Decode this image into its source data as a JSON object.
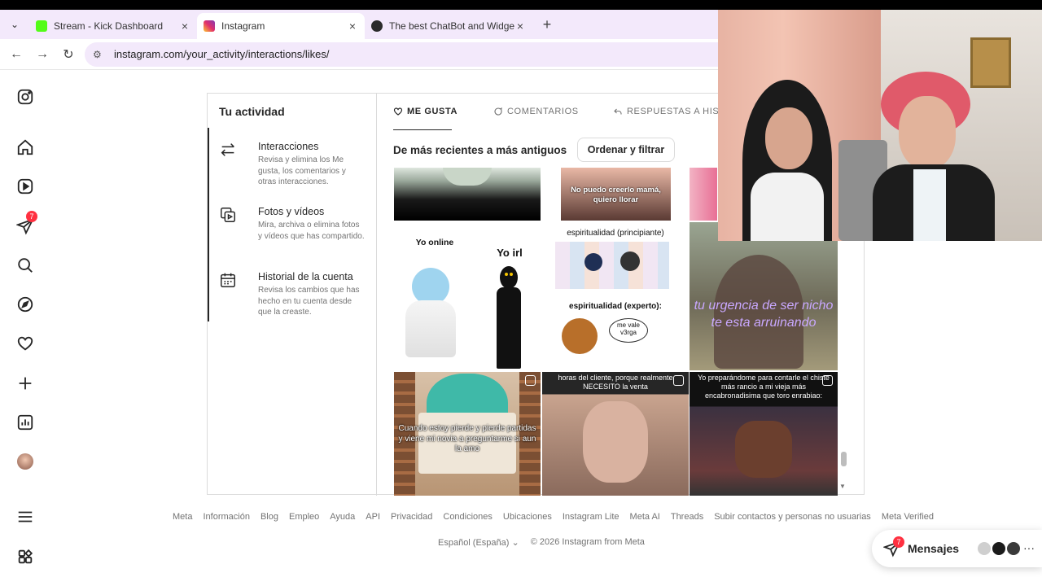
{
  "browser": {
    "tabs": [
      {
        "title": "Stream - Kick Dashboard",
        "favicon_color": "#53fc18",
        "active": false
      },
      {
        "title": "Instagram",
        "favicon_color": "#e1306c",
        "active": true
      },
      {
        "title": "The best ChatBot and Widgets",
        "favicon_color": "#2b2b2b",
        "active": false
      }
    ],
    "url": "instagram.com/your_activity/interactions/likes/"
  },
  "nav": {
    "notifications_badge": "7",
    "icons": [
      "instagram-logo-icon",
      "home-icon",
      "reels-icon",
      "direct-icon",
      "search-icon",
      "explore-icon",
      "heart-icon",
      "create-icon",
      "dashboard-icon",
      "profile-avatar",
      "menu-icon",
      "apps-icon"
    ]
  },
  "activity": {
    "title": "Tu actividad",
    "items": [
      {
        "title": "Interacciones",
        "desc": "Revisa y elimina los Me gusta, los comentarios y otras interacciones."
      },
      {
        "title": "Fotos y vídeos",
        "desc": "Mira, archiva o elimina fotos y vídeos que has compartido."
      },
      {
        "title": "Historial de la cuenta",
        "desc": "Revisa los cambios que has hecho en tu cuenta desde que la creaste."
      }
    ],
    "tabs": [
      "ME GUSTA",
      "COMENTARIOS",
      "RESPUESTAS A HISTO"
    ],
    "sort_label": "De más recientes a más antiguos",
    "sort_button": "Ordenar y filtrar",
    "grid": {
      "captions": [
        "No puedo creerlo mamá, quiero llorar",
        "Yo online",
        "Yo irl",
        "espiritualidad (principiante)",
        "espiritualidad (experto):",
        "me vale v3rga",
        "tu urgencia de ser nicho te esta arruinando",
        "Cuando estoy pierde y pierde partidas y viene mi novia a preguntarme si aun la amo",
        "horas del cliente, porque realmente NECESITO la venta",
        "Yo preparándome para contarle el chiste más rancio a mi vieja más encabronadisima que toro enrabiao:"
      ]
    }
  },
  "footer": {
    "links": [
      "Meta",
      "Información",
      "Blog",
      "Empleo",
      "Ayuda",
      "API",
      "Privacidad",
      "Condiciones",
      "Ubicaciones",
      "Instagram Lite",
      "Meta AI",
      "Threads",
      "Subir contactos y personas no usuarias",
      "Meta Verified"
    ],
    "language": "Español (España)",
    "copyright": "© 2026 Instagram from Meta"
  },
  "messages": {
    "label": "Mensajes",
    "badge": "7"
  }
}
